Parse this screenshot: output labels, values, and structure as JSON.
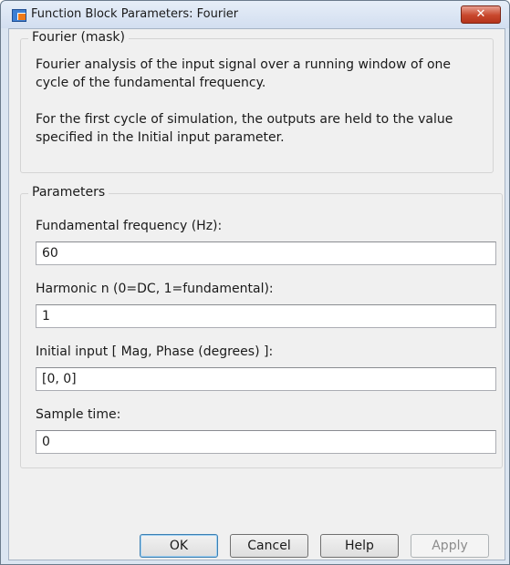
{
  "window": {
    "title": "Function Block Parameters: Fourier",
    "close_glyph": "✕"
  },
  "mask": {
    "legend": "Fourier (mask)",
    "description_1": "Fourier analysis of the input signal over a running window of one cycle of the fundamental frequency.",
    "description_2": "For the first cycle of simulation, the outputs are held  to the value specified in the Initial input parameter."
  },
  "parameters": {
    "legend": "Parameters",
    "fields": [
      {
        "label": "Fundamental frequency (Hz):",
        "value": "60"
      },
      {
        "label": "Harmonic n (0=DC, 1=fundamental):",
        "value": "1"
      },
      {
        "label": "Initial input [ Mag, Phase (degrees) ]:",
        "value": "[0, 0]"
      },
      {
        "label": "Sample time:",
        "value": "0"
      }
    ]
  },
  "buttons": {
    "ok": "OK",
    "cancel": "Cancel",
    "help": "Help",
    "apply": "Apply"
  }
}
